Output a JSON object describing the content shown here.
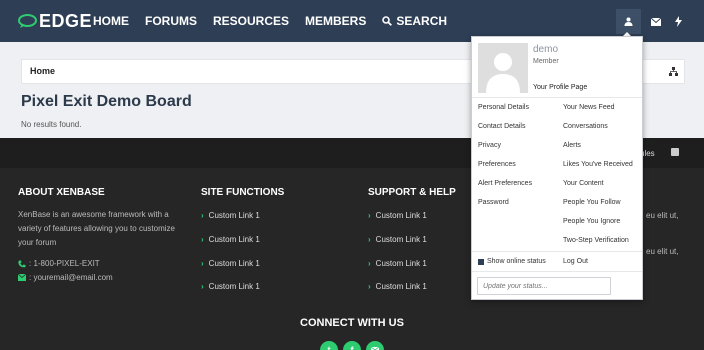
{
  "header": {
    "logo_text": "EDGE",
    "nav": [
      "HOME",
      "FORUMS",
      "RESOURCES",
      "MEMBERS",
      "SEARCH"
    ],
    "icons": [
      "user-icon",
      "envelope-icon",
      "bolt-icon"
    ]
  },
  "breadcrumb": {
    "label": "Home",
    "icon": "sitemap-icon"
  },
  "page": {
    "title": "Pixel Exit Demo Board",
    "message": "No results found."
  },
  "footer": {
    "rules_text": "ules",
    "about": {
      "title": "ABOUT XENBASE",
      "text": "XenBase is an awesome framework with a variety of features allowing you to customize your forum",
      "phone": ": 1-800-PIXEL-EXIT",
      "email": ": youremail@email.com"
    },
    "site_functions": {
      "title": "SITE FUNCTIONS",
      "links": [
        "Custom Link 1",
        "Custom Link 1",
        "Custom Link 1",
        "Custom Link 1"
      ]
    },
    "support": {
      "title": "SUPPORT & HELP",
      "links": [
        "Custom Link 1",
        "Custom Link 1",
        "Custom Link 1",
        "Custom Link 1"
      ]
    },
    "lorem_fragments": [
      "eu elit ut,",
      "eu elit ut,"
    ],
    "connect_title": "CONNECT WITH US",
    "social": [
      "twitter-icon",
      "facebook-icon",
      "email-icon"
    ],
    "accent": "#2ecc71"
  },
  "dropdown": {
    "name": "demo",
    "role": "Member",
    "profile_link": "Your Profile Page",
    "left_links": [
      "Personal Details",
      "Contact Details",
      "Privacy",
      "Preferences",
      "Alert Preferences",
      "Password"
    ],
    "right_links": [
      "Your News Feed",
      "Conversations",
      "Alerts",
      "Likes You've Received",
      "Your Content",
      "People You Follow",
      "People You Ignore",
      "Two-Step Verification"
    ],
    "show_online": "Show online status",
    "logout": "Log Out",
    "status_placeholder": "Update your status..."
  },
  "colors": {
    "header_bg": "#2e3e54",
    "footer_bg": "#262626",
    "accent": "#2ecc71"
  }
}
